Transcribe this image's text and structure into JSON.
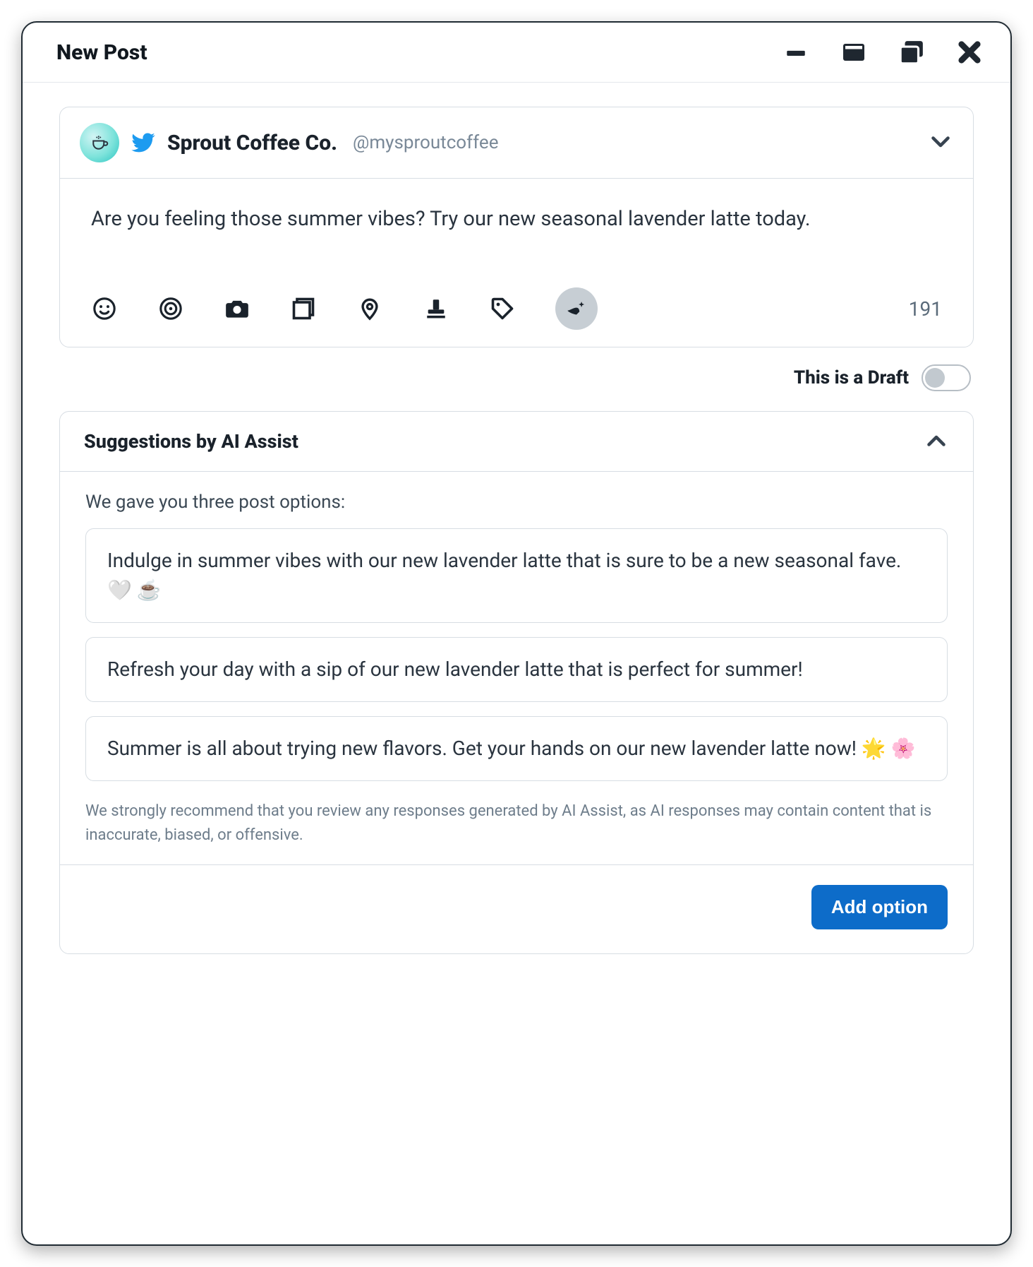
{
  "window": {
    "title": "New Post"
  },
  "account": {
    "name": "Sprout Coffee Co.",
    "handle": "@mysproutcoffee"
  },
  "compose": {
    "text": "Are you feeling those summer vibes? Try our new seasonal lavender latte today.",
    "char_count": "191"
  },
  "toolbar_icons": {
    "emoji": "emoji-icon",
    "target": "target-icon",
    "camera": "camera-icon",
    "gallery": "gallery-icon",
    "location": "location-icon",
    "stamp": "stamp-icon",
    "tag": "tag-icon",
    "ai": "ai-assist-icon"
  },
  "draft": {
    "label": "This is a Draft",
    "on": false
  },
  "suggestions": {
    "title": "Suggestions by AI Assist",
    "intro": "We gave you three post options:",
    "options": [
      "Indulge in summer vibes with our new lavender latte that is sure to be a new seasonal fave. 🤍 ☕",
      "Refresh your day with a sip of our new lavender latte that is perfect for summer!",
      "Summer is all about trying new flavors. Get your hands on our new lavender latte now! 🌟 🌸"
    ],
    "disclaimer": "We strongly recommend that you review any responses generated by AI Assist, as AI responses may contain content that is inaccurate, biased, or offensive."
  },
  "footer": {
    "add_option": "Add option"
  }
}
